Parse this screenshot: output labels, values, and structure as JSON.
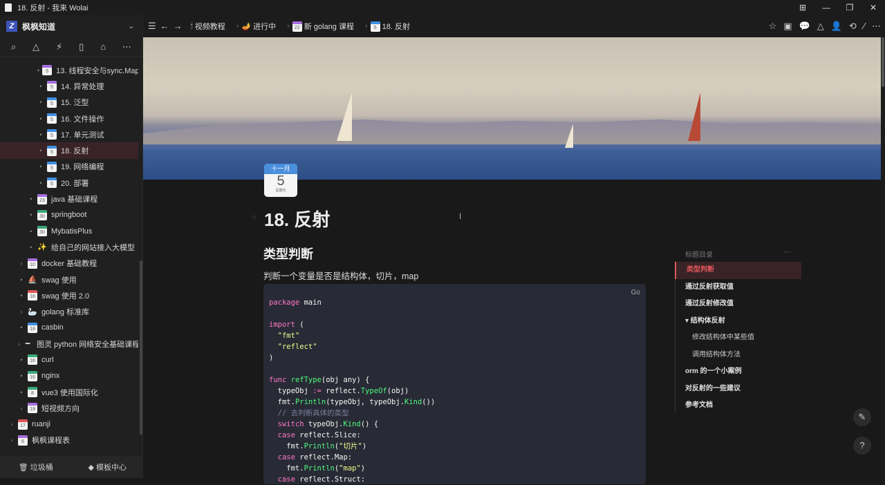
{
  "window": {
    "title": "18. 反射 - 我来 Wolai",
    "controls": [
      "⊞",
      "—",
      "❐",
      "✕"
    ]
  },
  "workspace": {
    "name": "枫枫知道",
    "logo": "Z"
  },
  "sidebar_tools": [
    "search-icon",
    "graph-icon",
    "flash-icon",
    "book-icon",
    "inbox-icon",
    "more-icon"
  ],
  "tree": [
    {
      "label": "13. 线程安全与sync.Map",
      "day": "5",
      "color": "#a66de0",
      "level": 2,
      "toggle": "•"
    },
    {
      "label": "14. 异常处理",
      "day": "5",
      "color": "#a66de0",
      "level": 2,
      "toggle": "•"
    },
    {
      "label": "15. 泛型",
      "day": "5",
      "color": "#3d8fe0",
      "level": 2,
      "toggle": "•"
    },
    {
      "label": "16. 文件操作",
      "day": "5",
      "color": "#3d8fe0",
      "level": 2,
      "toggle": "•"
    },
    {
      "label": "17. 单元测试",
      "day": "5",
      "color": "#3d8fe0",
      "level": 2,
      "toggle": "•"
    },
    {
      "label": "18. 反射",
      "day": "5",
      "color": "#3d8fe0",
      "level": 2,
      "toggle": "•",
      "active": true
    },
    {
      "label": "19. 网络编程",
      "day": "5",
      "color": "#3d8fe0",
      "level": 2,
      "toggle": "•"
    },
    {
      "label": "20. 部署",
      "day": "5",
      "color": "#3d8fe0",
      "level": 2,
      "toggle": "•"
    },
    {
      "label": "java 基础课程",
      "day": "23",
      "color": "#a66de0",
      "level": 1,
      "toggle": "•"
    },
    {
      "label": "springboot",
      "day": "30",
      "color": "#3aa87a",
      "level": 1,
      "toggle": "•"
    },
    {
      "label": "MybatisPlus",
      "day": "30",
      "color": "#3aa87a",
      "level": 1,
      "toggle": "•"
    },
    {
      "label": "给自己的网站接入大模型",
      "emoji": "✨",
      "level": 1,
      "toggle": "•"
    },
    {
      "label": "docker 基础教程",
      "day": "10",
      "color": "#a66de0",
      "level": 0,
      "toggle": "›"
    },
    {
      "label": "swag 使用",
      "emoji": "⛵",
      "level": 0,
      "toggle": "•"
    },
    {
      "label": "swag 使用 2.0",
      "day": "16",
      "color": "#e05555",
      "level": 0,
      "toggle": "•"
    },
    {
      "label": "golang 标准库",
      "emoji": "🦢",
      "level": 0,
      "toggle": "›"
    },
    {
      "label": "casbin",
      "day": "18",
      "color": "#3d8fe0",
      "level": 0,
      "toggle": "•"
    },
    {
      "label": "图灵 python 网络安全基础课程",
      "emoji": "━",
      "level": 0,
      "toggle": "›"
    },
    {
      "label": "curl",
      "day": "16",
      "color": "#3aa87a",
      "level": 0,
      "toggle": "•"
    },
    {
      "label": "nginx",
      "day": "16",
      "color": "#3aa87a",
      "level": 0,
      "toggle": "•"
    },
    {
      "label": "vue3 使用国际化",
      "day": "8",
      "color": "#3aa87a",
      "level": 0,
      "toggle": "•"
    },
    {
      "label": "短视频方向",
      "day": "19",
      "color": "#a66de0",
      "level": 0,
      "toggle": "›"
    },
    {
      "label": "ruanji",
      "day": "17",
      "color": "#e05555",
      "level": -1,
      "toggle": "›"
    },
    {
      "label": "枫枫课程表",
      "day": "6",
      "color": "#a66de0",
      "level": -1,
      "toggle": "›"
    }
  ],
  "sidebar_bottom": {
    "trash": "垃圾桶",
    "templates": "模板中心"
  },
  "breadcrumb": [
    {
      "label": "视频教程",
      "emoji": "🕯"
    },
    {
      "label": "进行中",
      "emoji": "🪔"
    },
    {
      "label": "新 golang 课程",
      "day": "22",
      "color": "#a66de0"
    },
    {
      "label": "18. 反射",
      "day": "5",
      "color": "#3d8fe0"
    }
  ],
  "header_icons": [
    "☆",
    "▣",
    "💬",
    "△",
    "👤",
    "⟲",
    "⁄",
    "⋯"
  ],
  "date_widget": {
    "month": "十一月",
    "day": "5",
    "weekday": "星期日"
  },
  "page": {
    "title": "18. 反射",
    "heading": "类型判断",
    "paragraph": "判断一个变量是否是结构体，切片，map"
  },
  "code": {
    "language": "Go",
    "text": "<span class=\"k\">package</span> main\n\n<span class=\"k\">import</span> (\n  <span class=\"s\">\"fmt\"</span>\n  <span class=\"s\">\"reflect\"</span>\n)\n\n<span class=\"k\">func</span> <span class=\"f\">refType</span>(obj any) {\n  typeObj <span class=\"k\">:=</span> reflect.<span class=\"f\">TypeOf</span>(obj)\n  fmt.<span class=\"f\">Println</span>(typeObj, typeObj.<span class=\"f\">Kind</span>())\n  <span class=\"c\">// 去判断具体的类型</span>\n  <span class=\"k\">switch</span> typeObj.<span class=\"f\">Kind</span>() {\n  <span class=\"k\">case</span> reflect.Slice:\n    fmt.<span class=\"f\">Println</span>(<span class=\"s\">\"切片\"</span>)\n  <span class=\"k\">case</span> reflect.Map:\n    fmt.<span class=\"f\">Println</span>(<span class=\"s\">\"map\"</span>)\n  <span class=\"k\">case</span> reflect.Struct:"
  },
  "toc": {
    "title": "标题目录",
    "items": [
      {
        "label": "类型判断",
        "active": true
      },
      {
        "label": "通过反射获取值"
      },
      {
        "label": "通过反射修改值"
      },
      {
        "label": "▾ 结构体反射"
      },
      {
        "label": "修改结构体中某些值",
        "sub": true
      },
      {
        "label": "调用结构体方法",
        "sub": true
      },
      {
        "label": "orm 的一个小案例"
      },
      {
        "label": "对反射的一些建议"
      },
      {
        "label": "参考文档"
      }
    ]
  }
}
